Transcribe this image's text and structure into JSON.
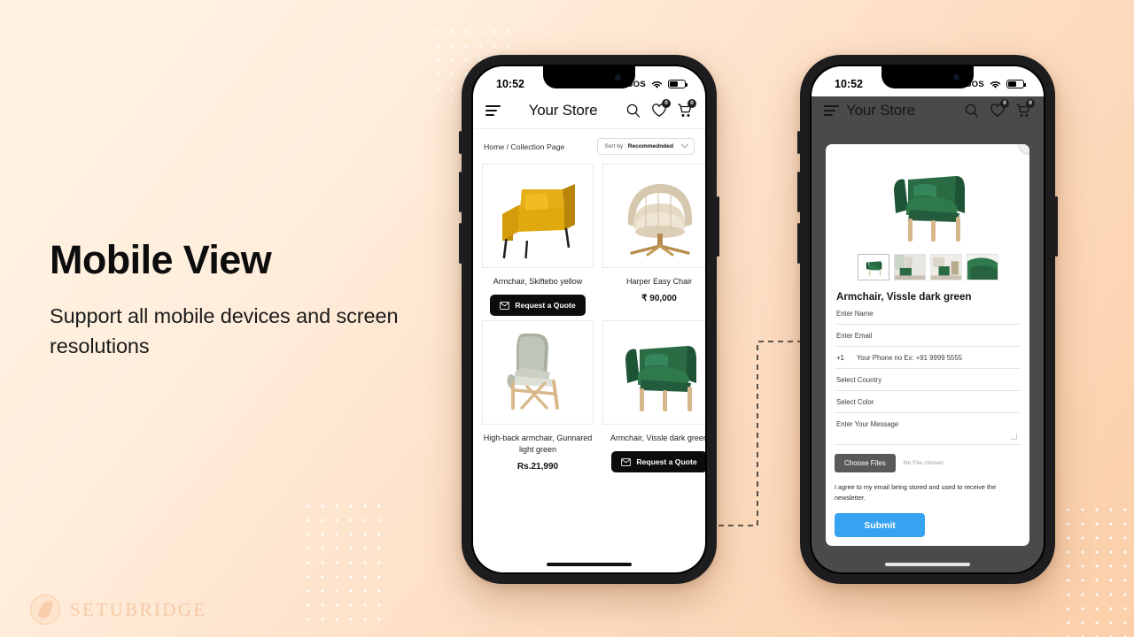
{
  "hero": {
    "headline": "Mobile View",
    "subhead": "Support all mobile devices and screen resolutions"
  },
  "watermark": {
    "text": "SETUBRIDGE"
  },
  "colors": {
    "bg_start": "#FFF3E4",
    "bg_end": "#FBCFA9",
    "accent_submit": "#35A3F2",
    "quote_button": "#0C0C0C",
    "choose_files": "#595959",
    "dim_overlay": "#4B4A4A"
  },
  "phone_collection": {
    "status_bar": {
      "time": "10:52",
      "sos": "SOS",
      "wifi": "wifi-icon",
      "battery": "battery-icon"
    },
    "header": {
      "menu": "hamburger-icon",
      "title": "Your Store",
      "search": "search-icon",
      "wishlist": "heart-icon",
      "wishlist_count": "0",
      "cart": "cart-icon",
      "cart_count": "0"
    },
    "breadcrumb": "Home / Collection Page",
    "sort": {
      "label": "Sort by : ",
      "value": "Recommednded"
    },
    "products": [
      {
        "title": "Armchair, Skiftebo yellow",
        "price": "",
        "button": "Request a Quote",
        "has_button": true
      },
      {
        "title": "Harper Easy Chair",
        "price": "₹ 90,000",
        "button": "",
        "has_button": false
      },
      {
        "title": "High-back armchair, Gunnared light green",
        "price": "Rs.21,990",
        "button": "",
        "has_button": false
      },
      {
        "title": "Armchair, Vissle dark green",
        "price": "",
        "button": "Request a Quote",
        "has_button": true
      }
    ]
  },
  "phone_modal": {
    "status_bar": {
      "time": "10:52",
      "sos": "SOS"
    },
    "header": {
      "title": "Your Store",
      "wishlist_count": "0",
      "cart_count": "0"
    },
    "modal": {
      "close": "×",
      "product_title": "Armchair, Vissle dark green",
      "thumbnails": [
        "thumb-1",
        "thumb-2",
        "thumb-3",
        "thumb-4"
      ],
      "fields": {
        "name": "Enter Name",
        "email": "Enter Email",
        "phone_code": "+1",
        "phone": "Your Phone no Ex: +91 9999 5555",
        "country": "Select Country",
        "color": "Select Color",
        "message": "Enter Your Message"
      },
      "file": {
        "button": "Choose Files",
        "status": "No File chosen"
      },
      "consent": "I agree to my email being stored and used to receive the newsletter.",
      "submit": "Submit"
    }
  }
}
